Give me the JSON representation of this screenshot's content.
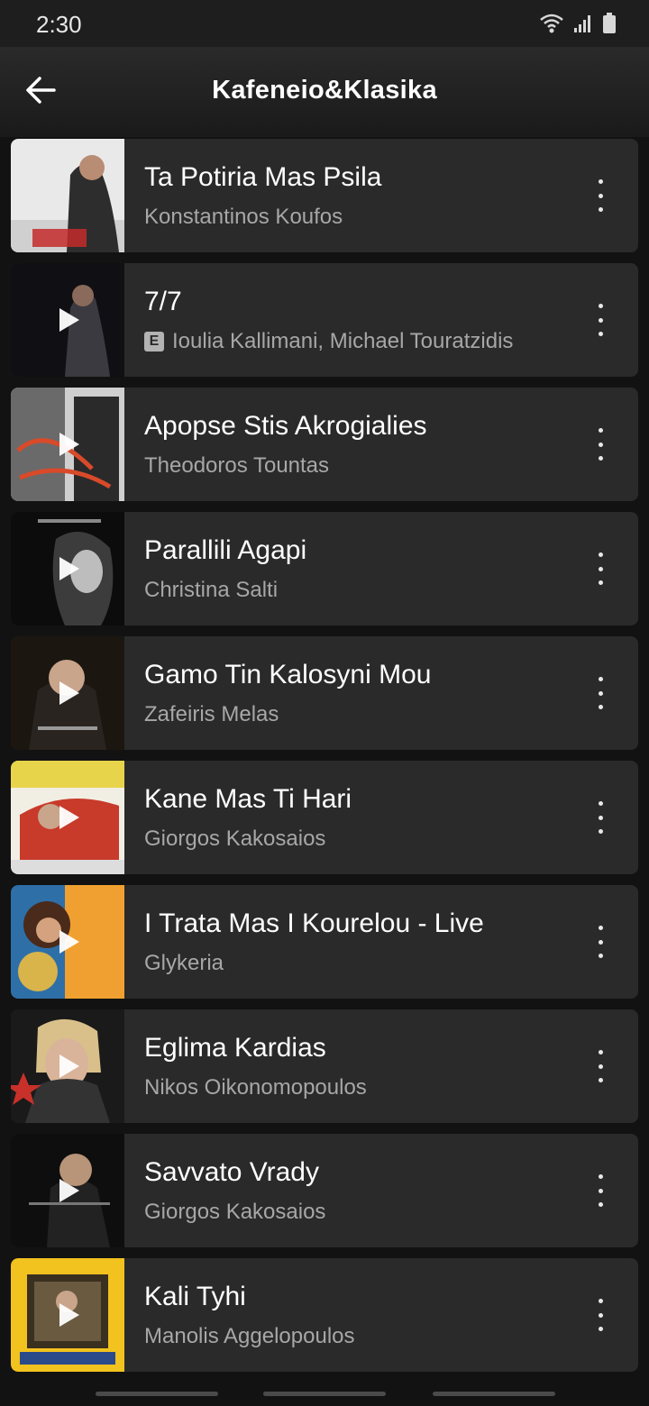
{
  "status": {
    "time": "2:30"
  },
  "header": {
    "title": "Kafeneio&Klasika"
  },
  "tracks": [
    {
      "title": "Ta Potiria Mas Psila",
      "artist": "Konstantinos Koufos",
      "explicit": false
    },
    {
      "title": "7/7",
      "artist": "Ioulia Kallimani, Michael Touratzidis",
      "explicit": true,
      "explicit_label": "E"
    },
    {
      "title": "Apopse Stis Akrogialies",
      "artist": "Theodoros Tountas",
      "explicit": false
    },
    {
      "title": "Parallili Agapi",
      "artist": "Christina Salti",
      "explicit": false
    },
    {
      "title": "Gamo Tin Kalosyni Mou",
      "artist": "Zafeiris Melas",
      "explicit": false
    },
    {
      "title": "Kane Mas Ti Hari",
      "artist": "Giorgos Kakosaios",
      "explicit": false
    },
    {
      "title": "I Trata Mas I Kourelou - Live",
      "artist": "Glykeria",
      "explicit": false
    },
    {
      "title": "Eglima Kardias",
      "artist": "Nikos Oikonomopoulos",
      "explicit": false
    },
    {
      "title": "Savvato Vrady",
      "artist": "Giorgos Kakosaios",
      "explicit": false
    },
    {
      "title": "Kali Tyhi",
      "artist": "Manolis Aggelopoulos",
      "explicit": false
    }
  ],
  "colors": {
    "background": "#121212",
    "row": "#2a2a2a",
    "secondary_text": "#a7a7a7"
  }
}
